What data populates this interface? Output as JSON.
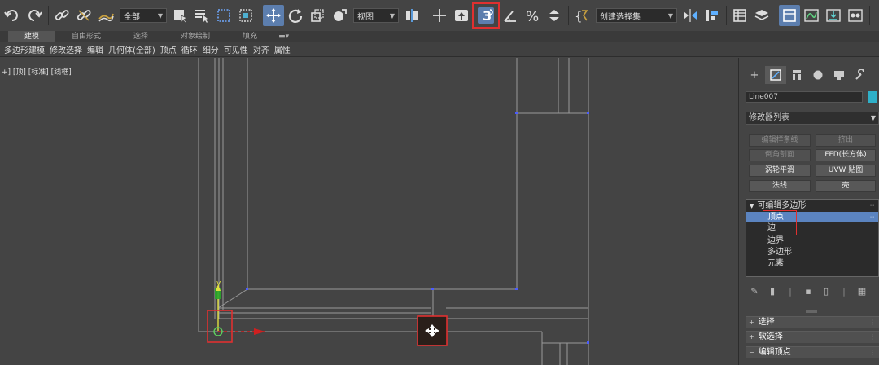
{
  "toolbar": {
    "selection_filter": "全部",
    "ref_coord": "视图",
    "named_selection": "创建选择集"
  },
  "ribbon": {
    "tabs": [
      "建模",
      "自由形式",
      "选择",
      "对象绘制",
      "填充"
    ],
    "sub_items": [
      "多边形建模",
      "修改选择",
      "编辑",
      "几何体(全部)",
      "顶点",
      "循环",
      "细分",
      "可见性",
      "对齐",
      "属性"
    ]
  },
  "viewport": {
    "label": "+] [顶] [标准] [线框]",
    "axis_y": "y"
  },
  "panel": {
    "object_name": "Line007",
    "object_color": "#2fb0c8",
    "modifier_list": "修改器列表",
    "buttons": {
      "edit_poly_stack": "编辑样条线",
      "extrude": "挤出",
      "chamfer": "倒角剖面",
      "ffd": "FFD(长方体)",
      "turbosmooth": "涡轮平滑",
      "uvw_map": "UVW 贴图",
      "normal": "法线",
      "shell": "壳"
    },
    "stack": {
      "root": "可编辑多边形",
      "items": [
        "顶点",
        "边",
        "边界",
        "多边形",
        "元素"
      ]
    },
    "rollouts": [
      "选择",
      "软选择",
      "编辑顶点"
    ]
  }
}
